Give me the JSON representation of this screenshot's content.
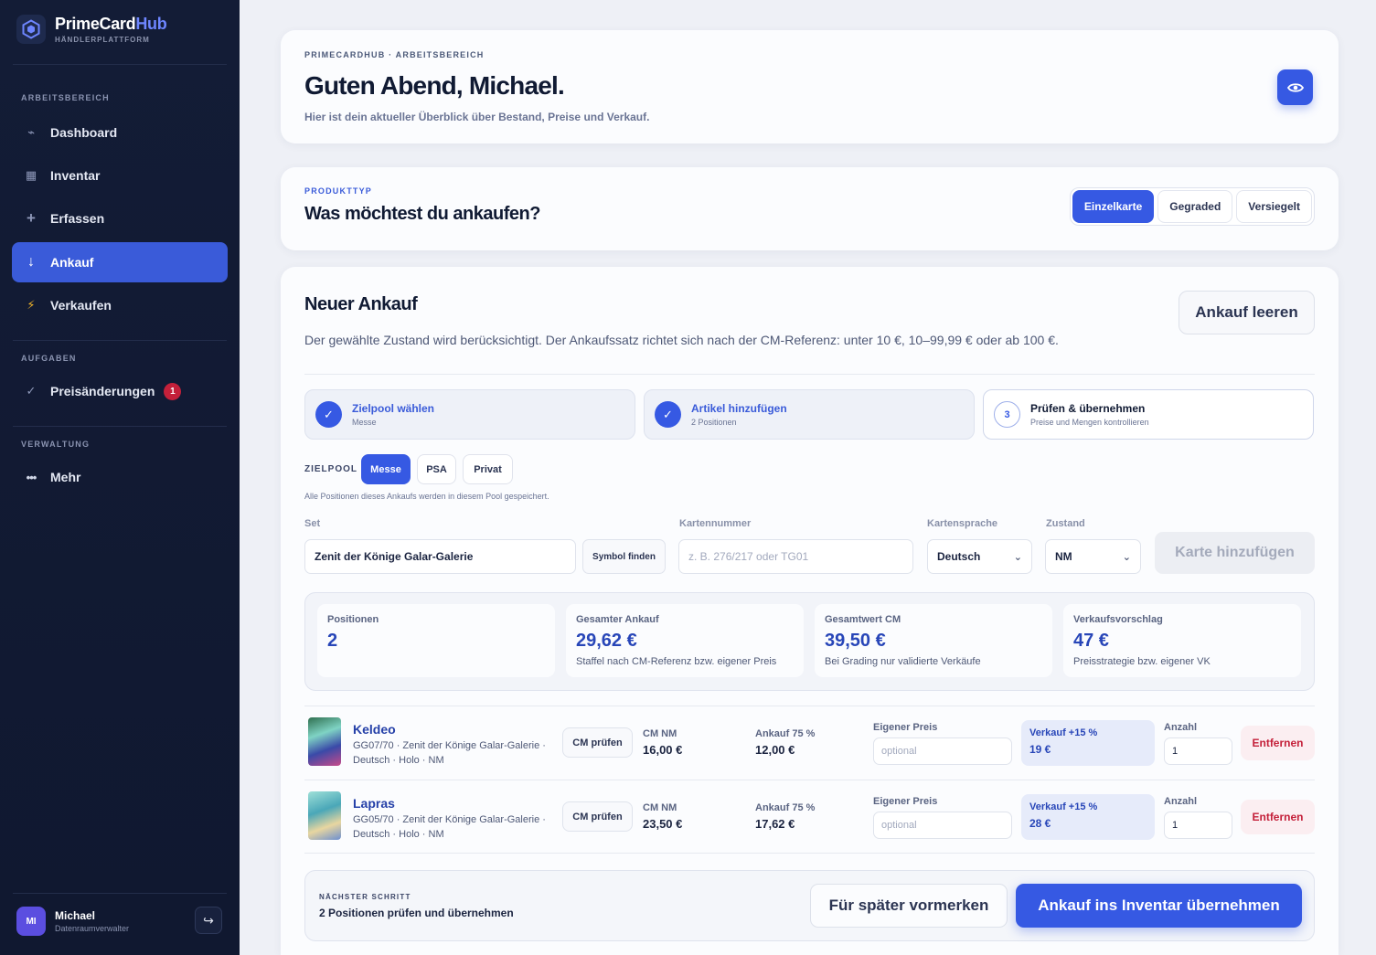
{
  "brand": {
    "name_part1": "PrimeCard",
    "name_part2": "Hub",
    "subtitle": "HÄNDLERPLATTFORM"
  },
  "sidebar": {
    "section_workspace": "ARBEITSBEREICH",
    "items": [
      {
        "label": "Dashboard",
        "icon": "activity-icon"
      },
      {
        "label": "Inventar",
        "icon": "grid-icon"
      },
      {
        "label": "Erfassen",
        "icon": "plus-icon"
      },
      {
        "label": "Ankauf",
        "icon": "arrow-down-icon",
        "active": true
      },
      {
        "label": "Verkaufen",
        "icon": "lightning-icon"
      }
    ],
    "section_tasks": "AUFGABEN",
    "tasks": {
      "label": "Preisänderungen",
      "badge": "1"
    },
    "section_admin": "VERWALTUNG",
    "more": {
      "label": "Mehr"
    },
    "user": {
      "initials": "MI",
      "name": "Michael",
      "role": "Datenraumverwalter"
    }
  },
  "header": {
    "kicker": "PRIMECARDHUB · ARBEITSBEREICH",
    "greeting": "Guten Abend, Michael.",
    "subtitle": "Hier ist dein aktueller Überblick über Bestand, Preise und Verkauf."
  },
  "product_type": {
    "kicker": "PRODUKTTYP",
    "question": "Was möchtest du ankaufen?",
    "options": [
      "Einzelkarte",
      "Gegraded",
      "Versiegelt"
    ],
    "selected": "Einzelkarte"
  },
  "purchase": {
    "title": "Neuer Ankauf",
    "clear_label": "Ankauf leeren",
    "description": "Der gewählte Zustand wird berücksichtigt. Der Ankaufssatz richtet sich nach der CM-Referenz: unter 10 €, 10–99,99 € oder ab 100 €.",
    "steps": [
      {
        "num": "1",
        "title": "Zielpool wählen",
        "sub": "Messe",
        "done": true
      },
      {
        "num": "2",
        "title": "Artikel hinzufügen",
        "sub": "2 Positionen",
        "done": true
      },
      {
        "num": "3",
        "title": "Prüfen & übernehmen",
        "sub": "Preise und Mengen kontrollieren",
        "done": false
      }
    ],
    "pool": {
      "label": "ZIELPOOL",
      "options": [
        "Messe",
        "PSA",
        "Privat"
      ],
      "selected": "Messe",
      "note": "Alle Positionen dieses Ankaufs werden in diesem Pool gespeichert."
    },
    "form": {
      "set_label": "Set",
      "set_value": "Zenit der Könige Galar-Galerie",
      "symbol_btn": "Symbol finden",
      "number_label": "Kartennummer",
      "number_placeholder": "z. B. 276/217 oder TG01",
      "language_label": "Kartensprache",
      "language_value": "Deutsch",
      "condition_label": "Zustand",
      "condition_value": "NM",
      "add_btn": "Karte hinzufügen"
    },
    "stats": [
      {
        "label": "Positionen",
        "value": "2",
        "note": ""
      },
      {
        "label": "Gesamter Ankauf",
        "value": "29,62 €",
        "note": "Staffel nach CM-Referenz bzw. eigener Preis"
      },
      {
        "label": "Gesamtwert CM",
        "value": "39,50 €",
        "note": "Bei Grading nur validierte Verkäufe"
      },
      {
        "label": "Verkaufsvorschlag",
        "value": "47 €",
        "note": "Preisstrategie bzw. eigener VK"
      }
    ],
    "items": [
      {
        "name": "Keldeo",
        "meta1": "GG07/70 · Zenit der Könige Galar-Galerie ·",
        "meta2": "Deutsch · Holo · NM",
        "cm_btn": "CM prüfen",
        "cm_label": "CM NM",
        "cm_value": "16,00 €",
        "buy_label": "Ankauf 75 %",
        "buy_value": "12,00 €",
        "own_label": "Eigener Preis",
        "own_placeholder": "optional",
        "sell_label": "Verkauf +15 %",
        "sell_value": "19 €",
        "qty_label": "Anzahl",
        "qty_value": "1",
        "remove": "Entfernen"
      },
      {
        "name": "Lapras",
        "meta1": "GG05/70 · Zenit der Könige Galar-Galerie ·",
        "meta2": "Deutsch · Holo · NM",
        "cm_btn": "CM prüfen",
        "cm_label": "CM NM",
        "cm_value": "23,50 €",
        "buy_label": "Ankauf 75 %",
        "buy_value": "17,62 €",
        "own_label": "Eigener Preis",
        "own_placeholder": "optional",
        "sell_label": "Verkauf +15 %",
        "sell_value": "28 €",
        "qty_label": "Anzahl",
        "qty_value": "1",
        "remove": "Entfernen"
      }
    ],
    "next": {
      "kicker": "NÄCHSTER SCHRITT",
      "text": "2 Positionen prüfen und übernehmen",
      "later_btn": "Für später vormerken",
      "commit_btn": "Ankauf ins Inventar übernehmen"
    }
  },
  "colors": {
    "accent": "#3659e3",
    "sidebar_bg": "#131c36",
    "danger": "#c4203a"
  }
}
